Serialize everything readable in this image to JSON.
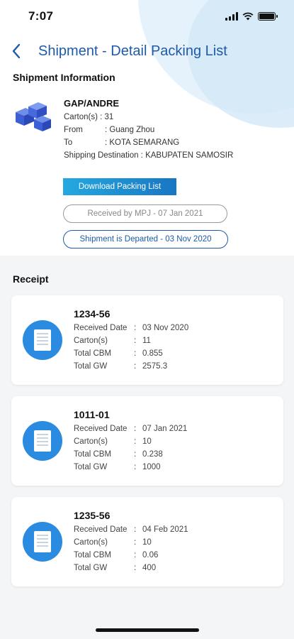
{
  "status": {
    "time": "7:07"
  },
  "nav": {
    "title": "Shipment - Detail Packing List"
  },
  "shipment_info": {
    "section_title": "Shipment Information",
    "name": "GAP/ANDRE",
    "fields": [
      {
        "label": "Carton(s) :",
        "value": "31"
      },
      {
        "label": "From",
        "value": ": Guang Zhou"
      },
      {
        "label": "To",
        "value": ": KOTA SEMARANG"
      },
      {
        "label": "Shipping Destination :",
        "value": "KABUPATEN SAMOSIR"
      }
    ],
    "download_label": "Download Packing List",
    "received_status": "Received by MPJ - 07 Jan 2021",
    "departed_status": "Shipment is Departed - 03 Nov 2020"
  },
  "receipt": {
    "section_title": "Receipt",
    "items": [
      {
        "id": "1234-56",
        "rows": [
          {
            "label": "Received Date",
            "sep": ":",
            "value": "03 Nov 2020"
          },
          {
            "label": "Carton(s)",
            "sep": ":",
            "value": "11"
          },
          {
            "label": "Total CBM",
            "sep": ":",
            "value": "0.855"
          },
          {
            "label": "Total GW",
            "sep": ":",
            "value": "2575.3"
          }
        ]
      },
      {
        "id": "1011-01",
        "rows": [
          {
            "label": "Received Date",
            "sep": ":",
            "value": "07 Jan 2021"
          },
          {
            "label": "Carton(s)",
            "sep": ":",
            "value": "10"
          },
          {
            "label": "Total CBM",
            "sep": ":",
            "value": "0.238"
          },
          {
            "label": "Total GW",
            "sep": ":",
            "value": "1000"
          }
        ]
      },
      {
        "id": "1235-56",
        "rows": [
          {
            "label": "Received Date",
            "sep": ":",
            "value": "04 Feb 2021"
          },
          {
            "label": "Carton(s)",
            "sep": ":",
            "value": "10"
          },
          {
            "label": "Total CBM",
            "sep": ":",
            "value": "0.06"
          },
          {
            "label": "Total GW",
            "sep": ":",
            "value": "400"
          }
        ]
      }
    ]
  },
  "colors": {
    "accent": "#1e5aa8",
    "button_gradient_start": "#25a8e0",
    "button_gradient_end": "#1976c2",
    "icon_circle": "#2b8be0"
  },
  "icons": {
    "back": "chevron-left-icon",
    "box": "boxes-icon",
    "receipt": "document-icon"
  }
}
